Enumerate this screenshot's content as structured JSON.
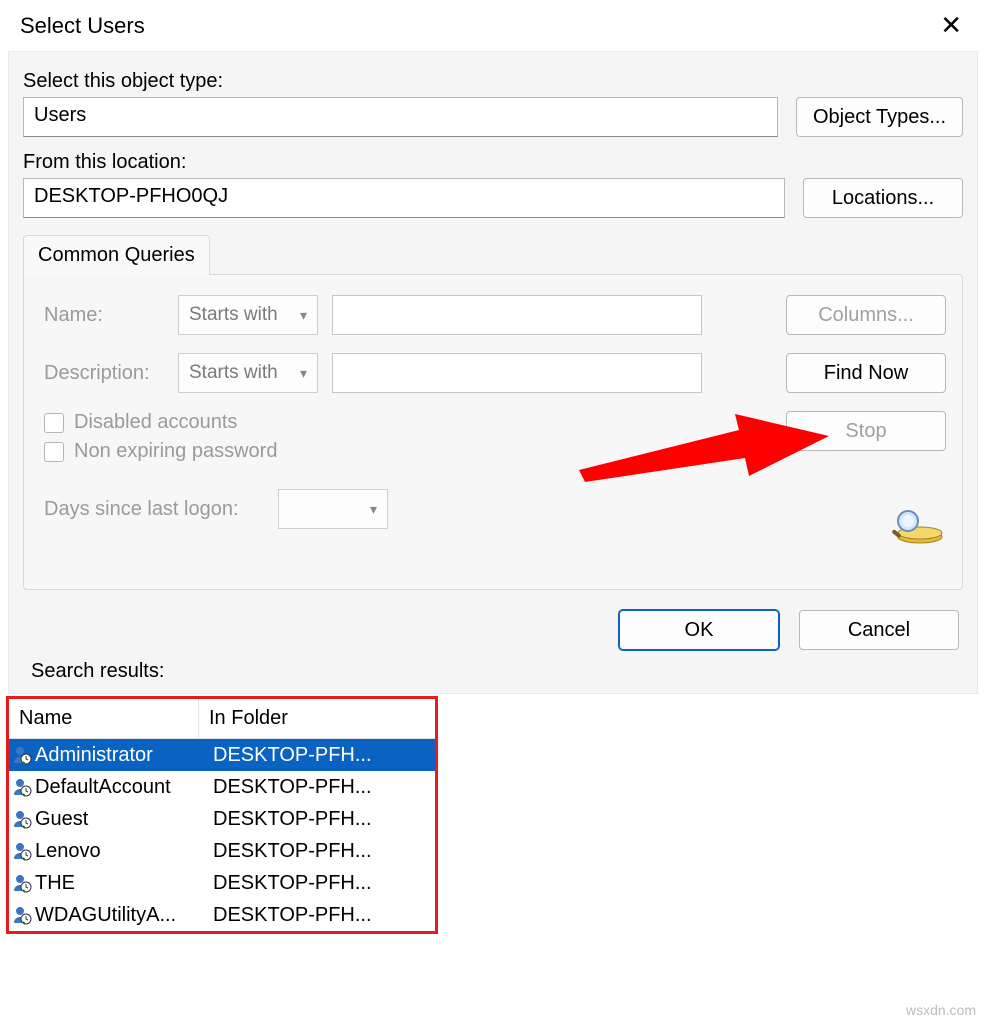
{
  "title": "Select Users",
  "labels": {
    "object_type": "Select this object type:",
    "location": "From this location:",
    "results": "Search results:"
  },
  "fields": {
    "object_type_value": "Users",
    "location_value": "DESKTOP-PFHO0QJ"
  },
  "buttons": {
    "object_types": "Object Types...",
    "locations": "Locations...",
    "columns": "Columns...",
    "find_now": "Find Now",
    "stop": "Stop",
    "ok": "OK",
    "cancel": "Cancel"
  },
  "tab": {
    "label": "Common Queries"
  },
  "common_queries": {
    "name_label": "Name:",
    "name_mode": "Starts with",
    "desc_label": "Description:",
    "desc_mode": "Starts with",
    "disabled": "Disabled accounts",
    "non_expiring": "Non expiring password",
    "days_label": "Days since last logon:"
  },
  "columns": {
    "name": "Name",
    "folder": "In Folder"
  },
  "results": [
    {
      "name": "Administrator",
      "folder": "DESKTOP-PFH...",
      "selected": true
    },
    {
      "name": "DefaultAccount",
      "folder": "DESKTOP-PFH...",
      "selected": false
    },
    {
      "name": "Guest",
      "folder": "DESKTOP-PFH...",
      "selected": false
    },
    {
      "name": "Lenovo",
      "folder": "DESKTOP-PFH...",
      "selected": false
    },
    {
      "name": "THE",
      "folder": "DESKTOP-PFH...",
      "selected": false
    },
    {
      "name": "WDAGUtilityA...",
      "folder": "DESKTOP-PFH...",
      "selected": false
    }
  ],
  "watermark": "wsxdn.com"
}
